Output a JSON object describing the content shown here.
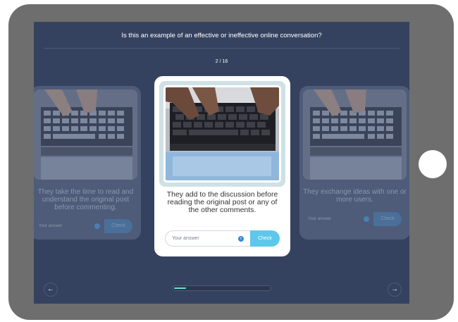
{
  "question": "Is this an example of an effective or ineffective online conversation?",
  "counter": "2 / 16",
  "progress": 0.125,
  "cards": {
    "left": {
      "text": "They take the time to read and understand the original post before commenting.",
      "placeholder": "Your answer",
      "check_label": "Check"
    },
    "center": {
      "text": "They add to the discussion before reading the original post or any of the other comments.",
      "placeholder": "Your answer",
      "check_label": "Check"
    },
    "right": {
      "text": "They exchange ideas with one or more users.",
      "placeholder": "Your answer",
      "check_label": "Check"
    }
  },
  "nav": {
    "prev_icon": "arrow-left-icon",
    "next_icon": "arrow-right-icon"
  },
  "colors": {
    "screen_bg": "#35425f",
    "accent": "#5ec7ec",
    "progress": "#6ee0c8"
  }
}
